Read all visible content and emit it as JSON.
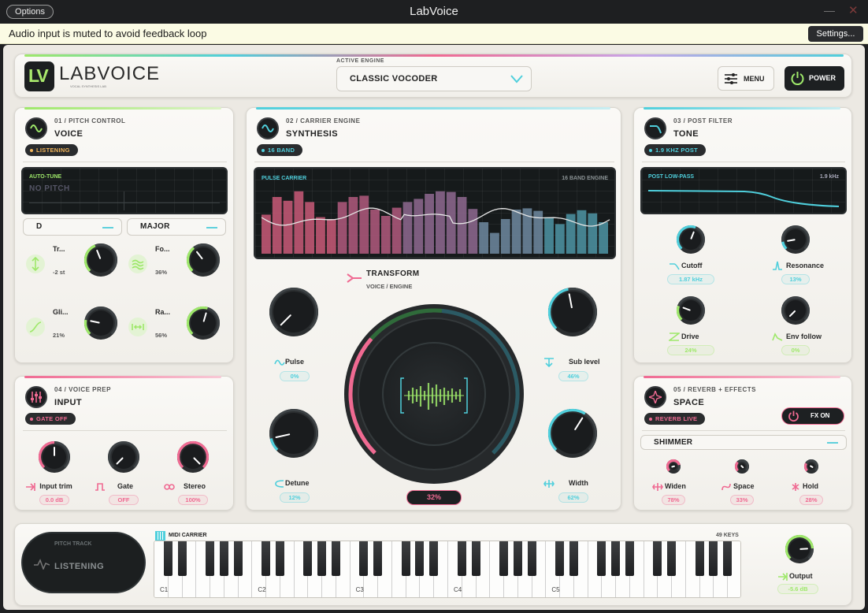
{
  "window": {
    "title": "LabVoice",
    "options_label": "Options",
    "minimize_glyph": "—",
    "close_glyph": "✕"
  },
  "notice": {
    "text": "Audio input is muted to avoid feedback loop",
    "settings_label": "Settings..."
  },
  "header": {
    "logo_letters": "LV",
    "logo_word": "LABVOICE",
    "logo_tagline": "VOCAL SYNTHESIS LAB",
    "engine_caption": "ACTIVE ENGINE",
    "engine_value": "CLASSIC VOCODER",
    "menu_label": "MENU",
    "power_label": "POWER"
  },
  "voice": {
    "num": "01  /  PITCH CONTROL",
    "title": "VOICE",
    "badge": "LISTENING",
    "screen_label": "AUTO-TUNE",
    "screen_value": "NO PITCH",
    "key": "D",
    "scale": "MAJOR",
    "knobs": [
      {
        "label": "Tr...",
        "value": "-2 st",
        "level": 0.42
      },
      {
        "label": "Fo...",
        "value": "36%",
        "level": 0.36
      },
      {
        "label": "Gli...",
        "value": "21%",
        "level": 0.21
      },
      {
        "label": "Ra...",
        "value": "56%",
        "level": 0.56
      }
    ]
  },
  "input": {
    "num": "04  /  VOICE PREP",
    "title": "INPUT",
    "badge": "GATE OFF",
    "knobs": [
      {
        "label": "Input trim",
        "value": "0.0 dB",
        "level": 0.5
      },
      {
        "label": "Gate",
        "value": "OFF",
        "level": 0.0
      },
      {
        "label": "Stereo",
        "value": "100%",
        "level": 1.0
      }
    ]
  },
  "synthesis": {
    "num": "02  /  CARRIER ENGINE",
    "title": "SYNTHESIS",
    "badge": "16 BAND",
    "screen_label": "PULSE CARRIER",
    "screen_right": "16 BAND ENGINE",
    "transform_title": "TRANSFORM",
    "transform_sub": "VOICE  /  ENGINE",
    "transform_value": "32%",
    "transform_level": 0.32,
    "knobs": [
      {
        "label": "Pulse",
        "value": "0%",
        "level": 0.0
      },
      {
        "label": "Sub level",
        "value": "46%",
        "level": 0.46
      },
      {
        "label": "Detune",
        "value": "12%",
        "level": 0.12
      },
      {
        "label": "Width",
        "value": "62%",
        "level": 0.62
      }
    ]
  },
  "tone": {
    "num": "03  /  POST FILTER",
    "title": "TONE",
    "badge": "1.9 KHZ POST",
    "screen_label": "POST LOW-PASS",
    "screen_right": "1.9 kHz",
    "knobs": [
      {
        "label": "Cutoff",
        "value": "1.87 kHz",
        "level": 0.58
      },
      {
        "label": "Resonance",
        "value": "13%",
        "level": 0.13
      },
      {
        "label": "Drive",
        "value": "24%",
        "level": 0.24
      },
      {
        "label": "Env follow",
        "value": "0%",
        "level": 0.0
      }
    ]
  },
  "space": {
    "num": "05  /  REVERB + EFFECTS",
    "title": "SPACE",
    "badge": "REVERB LIVE",
    "fx_label": "FX ON",
    "preset": "SHIMMER",
    "knobs": [
      {
        "label": "Widen",
        "value": "78%",
        "level": 0.78
      },
      {
        "label": "Space",
        "value": "33%",
        "level": 0.33
      },
      {
        "label": "Hold",
        "value": "28%",
        "level": 0.28
      }
    ]
  },
  "keyboard": {
    "pitch_caption": "PITCH TRACK",
    "pitch_status": "LISTENING",
    "midi_label": "MIDI CARRIER",
    "keys_count": "49 KEYS",
    "octaves": [
      "C1",
      "C2",
      "C3",
      "C4",
      "C5"
    ],
    "output_label": "Output",
    "output_value": "-5.6 dB",
    "output_level": 0.82
  },
  "colors": {
    "green": "#9ee86a",
    "cyan": "#4fcfdc",
    "pink": "#f06a92",
    "dark": "#1b1d1f"
  },
  "spectrum": {
    "bars": [
      0.62,
      0.9,
      0.84,
      0.99,
      0.82,
      0.58,
      0.55,
      0.82,
      0.9,
      0.92,
      0.7,
      0.6,
      0.73,
      0.82,
      0.87,
      0.95,
      0.99,
      0.98,
      0.9,
      0.71,
      0.5,
      0.33,
      0.55,
      0.7,
      0.72,
      0.68,
      0.58,
      0.47,
      0.63,
      0.69,
      0.64,
      0.5
    ]
  }
}
